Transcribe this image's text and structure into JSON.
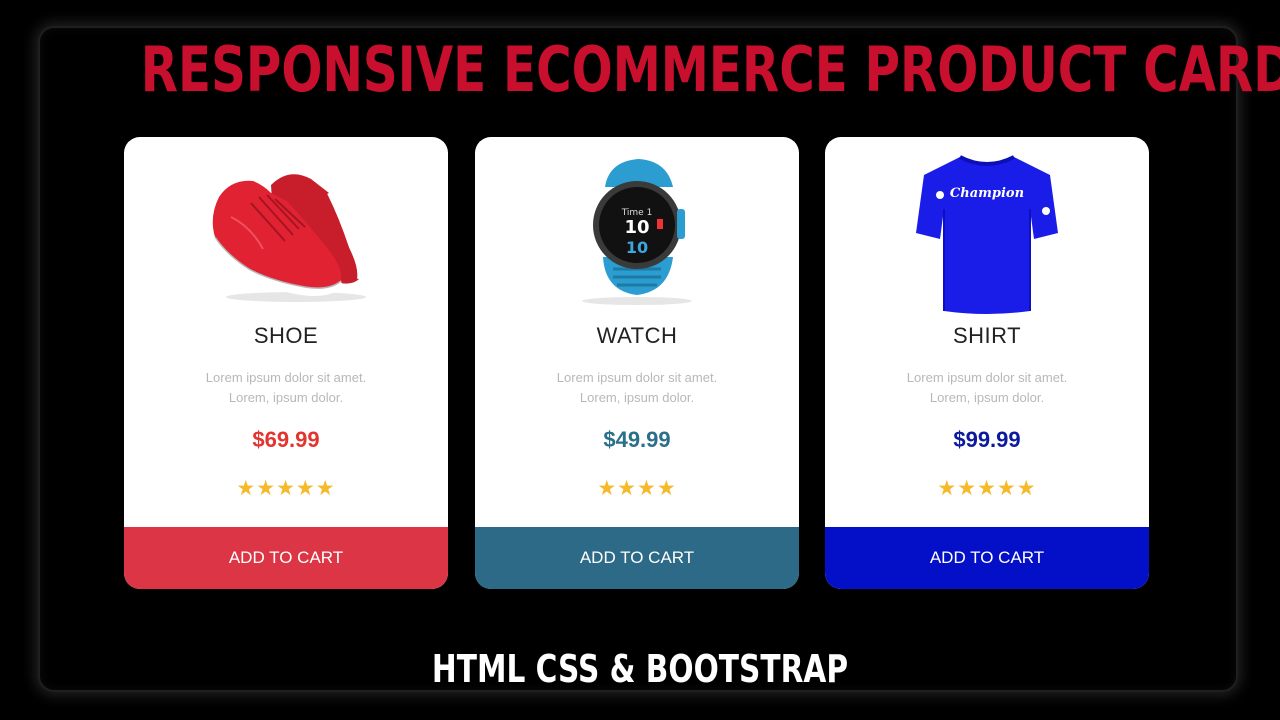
{
  "headline": "RESPONSIVE ECOMMERCE PRODUCT CARDS",
  "footer": "HTML CSS & BOOTSTRAP",
  "colors": {
    "headline": "#c8102e",
    "background": "#000000",
    "stars": "#f5b92a"
  },
  "products": [
    {
      "name": "SHOE",
      "desc_line1": "Lorem ipsum dolor sit amet.",
      "desc_line2": "Lorem, ipsum dolor.",
      "price": "$69.99",
      "rating": 5,
      "button": "ADD TO CART",
      "icon": "red-sneaker-icon",
      "price_color": "#e3342f",
      "button_color": "#dc3545"
    },
    {
      "name": "WATCH",
      "desc_line1": "Lorem ipsum dolor sit amet.",
      "desc_line2": "Lorem, ipsum dolor.",
      "price": "$49.99",
      "rating": 4,
      "button": "ADD TO CART",
      "icon": "smartwatch-icon",
      "price_color": "#2a6f8c",
      "button_color": "#2c6a87"
    },
    {
      "name": "SHIRT",
      "desc_line1": "Lorem ipsum dolor sit amet.",
      "desc_line2": "Lorem, ipsum dolor.",
      "price": "$99.99",
      "rating": 5,
      "button": "ADD TO CART",
      "icon": "tshirt-icon",
      "price_color": "#0b1a9e",
      "button_color": "#0410c8"
    }
  ]
}
